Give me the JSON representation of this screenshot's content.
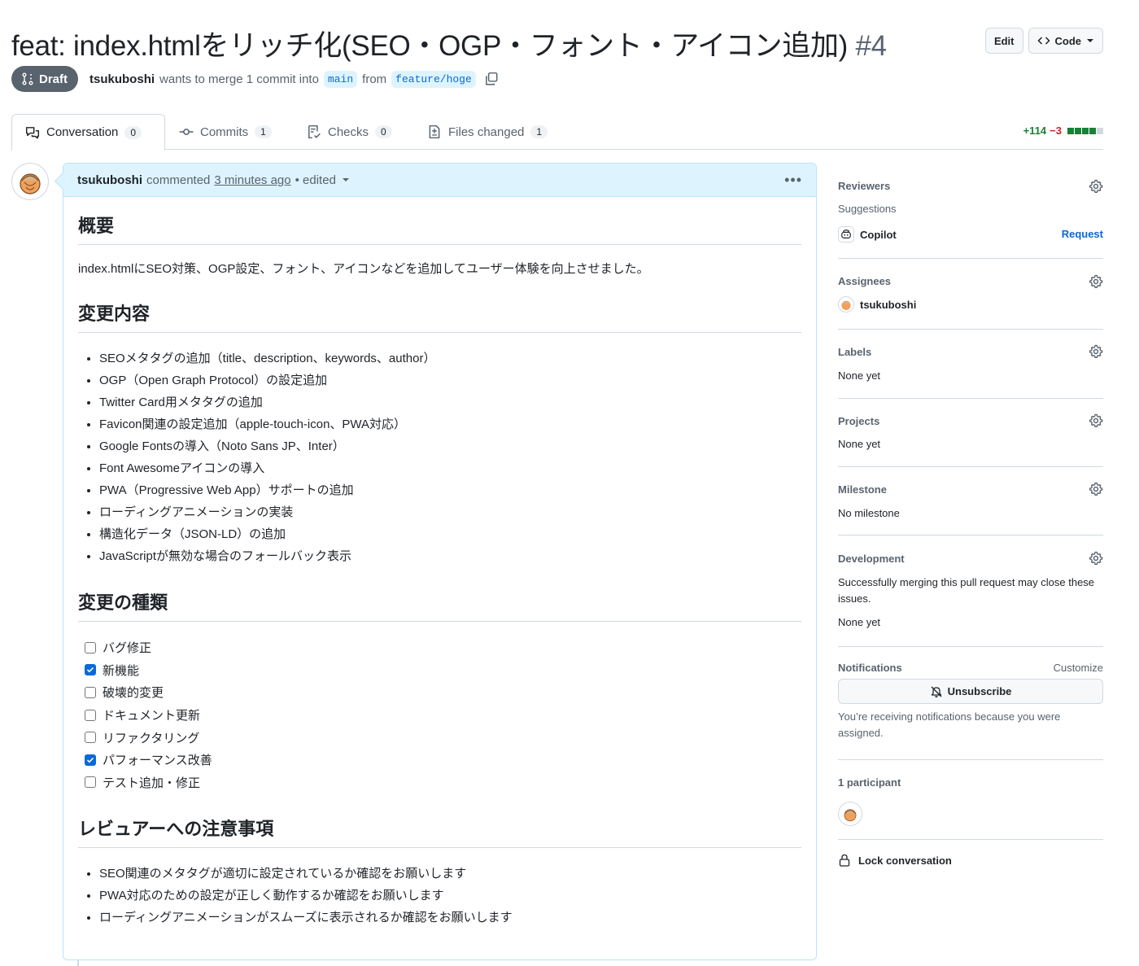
{
  "header": {
    "title": "feat: index.htmlをリッチ化(SEO・OGP・フォント・アイコン追加)",
    "number": "#4",
    "edit_label": "Edit",
    "code_label": "Code"
  },
  "meta": {
    "status": "Draft",
    "author": "tsukuboshi",
    "merge_text": "wants to merge 1 commit into",
    "base_branch": "main",
    "from_text": "from",
    "head_branch": "feature/hoge"
  },
  "tabs": [
    {
      "label": "Conversation",
      "count": "0"
    },
    {
      "label": "Commits",
      "count": "1"
    },
    {
      "label": "Checks",
      "count": "0"
    },
    {
      "label": "Files changed",
      "count": "1"
    }
  ],
  "diffstat": {
    "additions": "+114",
    "deletions": "−3"
  },
  "comment": {
    "author": "tsukuboshi",
    "action": "commented",
    "time": "3 minutes ago",
    "edited": "• edited",
    "h_overview": "概要",
    "overview_text": "index.htmlにSEO対策、OGP設定、フォント、アイコンなどを追加してユーザー体験を向上させました。",
    "h_changes": "変更内容",
    "changes": [
      "SEOメタタグの追加（title、description、keywords、author）",
      "OGP（Open Graph Protocol）の設定追加",
      "Twitter Card用メタタグの追加",
      "Favicon関連の設定追加（apple-touch-icon、PWA対応）",
      "Google Fontsの導入（Noto Sans JP、Inter）",
      "Font Awesomeアイコンの導入",
      "PWA（Progressive Web App）サポートの追加",
      "ローディングアニメーションの実装",
      "構造化データ（JSON-LD）の追加",
      "JavaScriptが無効な場合のフォールバック表示"
    ],
    "h_types": "変更の種類",
    "types": [
      {
        "label": "バグ修正",
        "checked": false
      },
      {
        "label": "新機能",
        "checked": true
      },
      {
        "label": "破壊的変更",
        "checked": false
      },
      {
        "label": "ドキュメント更新",
        "checked": false
      },
      {
        "label": "リファクタリング",
        "checked": false
      },
      {
        "label": "パフォーマンス改善",
        "checked": true
      },
      {
        "label": "テスト追加・修正",
        "checked": false
      }
    ],
    "h_notes": "レビュアーへの注意事項",
    "notes": [
      "SEO関連のメタタグが適切に設定されているか確認をお願いします",
      "PWA対応のための設定が正しく動作するか確認をお願いします",
      "ローディングアニメーションがスムーズに表示されるか確認をお願いします"
    ]
  },
  "sidebar": {
    "reviewers": {
      "title": "Reviewers",
      "suggestions": "Suggestions",
      "name": "Copilot",
      "action": "Request"
    },
    "assignees": {
      "title": "Assignees",
      "name": "tsukuboshi"
    },
    "labels": {
      "title": "Labels",
      "value": "None yet"
    },
    "projects": {
      "title": "Projects",
      "value": "None yet"
    },
    "milestone": {
      "title": "Milestone",
      "value": "No milestone"
    },
    "development": {
      "title": "Development",
      "text": "Successfully merging this pull request may close these issues.",
      "value": "None yet"
    },
    "notifications": {
      "title": "Notifications",
      "customize": "Customize",
      "button": "Unsubscribe",
      "reason": "You’re receiving notifications because you were assigned."
    },
    "participants": {
      "title": "1 participant"
    },
    "lock": "Lock conversation"
  },
  "colors": {
    "accent": "#0969da",
    "draft": "#59636e",
    "add": "#1a7f37",
    "del": "#cf222e"
  }
}
